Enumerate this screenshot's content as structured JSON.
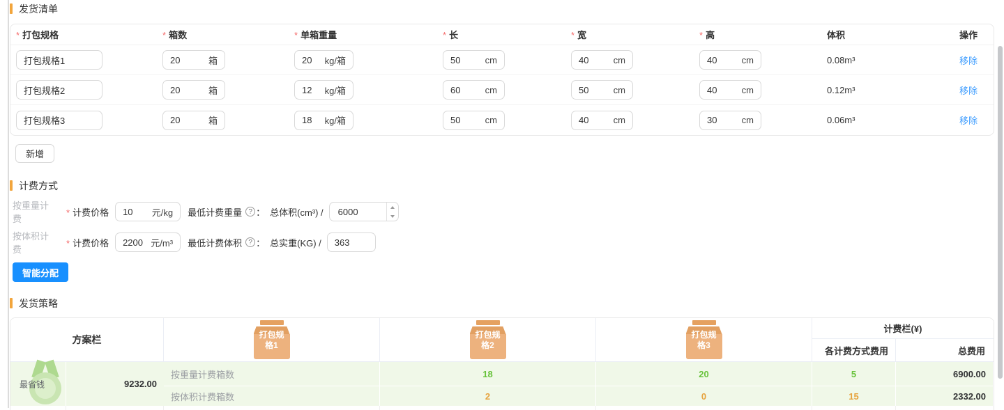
{
  "colors": {
    "accent_orange": "#f2a53c",
    "primary_blue": "#1890ff",
    "link_blue": "#409eff",
    "success_green": "#67c23a",
    "warning_orange": "#e6a23c",
    "strategy_row_bg": "#f0f8e8",
    "package_icon": "#edb27e"
  },
  "shipping_list": {
    "title": "发货清单",
    "columns": [
      {
        "label": "打包规格",
        "required": true
      },
      {
        "label": "箱数",
        "required": true
      },
      {
        "label": "单箱重量",
        "required": true
      },
      {
        "label": "长",
        "required": true
      },
      {
        "label": "宽",
        "required": true
      },
      {
        "label": "高",
        "required": true
      },
      {
        "label": "体积",
        "required": false
      },
      {
        "label": "操作",
        "required": false
      }
    ],
    "units": {
      "qty": "箱",
      "weight": "kg/箱",
      "dim": "cm"
    },
    "rows": [
      {
        "spec": "打包规格1",
        "qty": "20",
        "weight": "20",
        "length": "50",
        "width": "40",
        "height": "40",
        "volume": "0.08m³",
        "action": "移除"
      },
      {
        "spec": "打包规格2",
        "qty": "20",
        "weight": "12",
        "length": "60",
        "width": "50",
        "height": "40",
        "volume": "0.12m³",
        "action": "移除"
      },
      {
        "spec": "打包规格3",
        "qty": "20",
        "weight": "18",
        "length": "50",
        "width": "40",
        "height": "30",
        "volume": "0.06m³",
        "action": "移除"
      }
    ],
    "add_button": "新增"
  },
  "billing": {
    "title": "计费方式",
    "help_glyph": "?",
    "rows": [
      {
        "mode": "按重量计费",
        "price_label": "计费价格",
        "price": "10",
        "price_unit": "元/kg",
        "min_label": "最低计费重量",
        "colon": "：",
        "formula": "总体积(cm³) /",
        "value": "6000",
        "has_spinner": true
      },
      {
        "mode": "按体积计费",
        "price_label": "计费价格",
        "price": "2200",
        "price_unit": "元/m³",
        "min_label": "最低计费体积",
        "colon": "：",
        "formula": "总实重(KG) /",
        "value": "363",
        "has_spinner": false
      }
    ],
    "smart_button": "智能分配"
  },
  "strategy": {
    "title": "发货策略",
    "plan_header": "方案栏",
    "spec_headers": [
      "打包规格1",
      "打包规格2",
      "打包规格3"
    ],
    "fee_group_header": "计费栏(¥)",
    "fee_sub_headers": [
      "各计费方式费用",
      "总费用"
    ],
    "plan_badge": "最省钱",
    "rows": [
      {
        "label": "按重量计费箱数",
        "values": [
          "18",
          "20",
          "5"
        ],
        "fee": "6900.00"
      },
      {
        "label": "按体积计费箱数",
        "values": [
          "2",
          "0",
          "15"
        ],
        "fee": "2332.00"
      }
    ],
    "total_fee": "9232.00"
  }
}
